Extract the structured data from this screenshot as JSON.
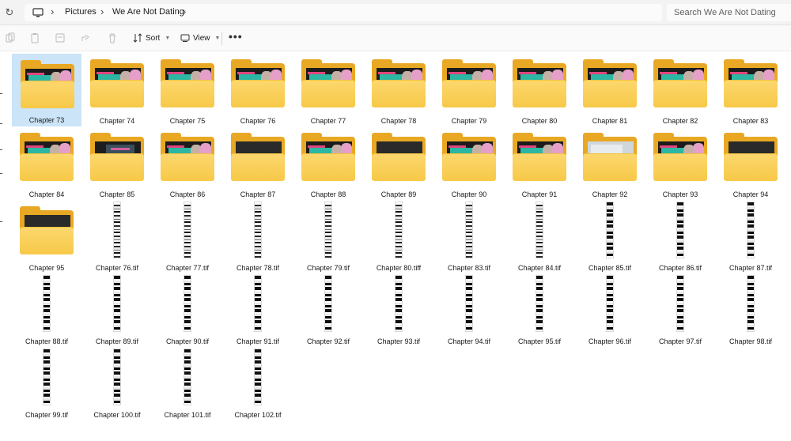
{
  "address": {
    "refresh_icon": "refresh-icon",
    "computer_icon": "computer-icon",
    "breadcrumbs": [
      "Pictures",
      "We Are Not Dating"
    ],
    "separator": "›"
  },
  "search": {
    "placeholder": "Search We Are Not Dating",
    "value": ""
  },
  "toolbar": {
    "sort_label": "Sort",
    "view_label": "View",
    "more_label": "•••",
    "icons": [
      "cut-icon",
      "copy-icon",
      "paste-icon",
      "share-icon",
      "delete-icon"
    ]
  },
  "colors": {
    "selection": "#cce4f7",
    "folder": "#f7c948",
    "accent_teal": "#2bb7a3"
  },
  "items": [
    {
      "name": "Chapter 73",
      "kind": "folder",
      "thumb": "comic",
      "selected": true
    },
    {
      "name": "Chapter 74",
      "kind": "folder",
      "thumb": "comic"
    },
    {
      "name": "Chapter 75",
      "kind": "folder",
      "thumb": "comic"
    },
    {
      "name": "Chapter 76",
      "kind": "folder",
      "thumb": "comic"
    },
    {
      "name": "Chapter 77",
      "kind": "folder",
      "thumb": "comic"
    },
    {
      "name": "Chapter 78",
      "kind": "folder",
      "thumb": "comic"
    },
    {
      "name": "Chapter 79",
      "kind": "folder",
      "thumb": "comic"
    },
    {
      "name": "Chapter 80",
      "kind": "folder",
      "thumb": "comic"
    },
    {
      "name": "Chapter 81",
      "kind": "folder",
      "thumb": "comic"
    },
    {
      "name": "Chapter 82",
      "kind": "folder",
      "thumb": "comic"
    },
    {
      "name": "Chapter 83",
      "kind": "folder",
      "thumb": "comic"
    },
    {
      "name": "Chapter 84",
      "kind": "folder",
      "thumb": "comic"
    },
    {
      "name": "Chapter 85",
      "kind": "folder",
      "thumb": "laptop"
    },
    {
      "name": "Chapter 86",
      "kind": "folder",
      "thumb": "comic"
    },
    {
      "name": "Chapter 87",
      "kind": "folder",
      "thumb": "blur"
    },
    {
      "name": "Chapter 88",
      "kind": "folder",
      "thumb": "comic"
    },
    {
      "name": "Chapter 89",
      "kind": "folder",
      "thumb": "blur"
    },
    {
      "name": "Chapter 90",
      "kind": "folder",
      "thumb": "comic"
    },
    {
      "name": "Chapter 91",
      "kind": "folder",
      "thumb": "comic"
    },
    {
      "name": "Chapter 92",
      "kind": "folder",
      "thumb": "light"
    },
    {
      "name": "Chapter 93",
      "kind": "folder",
      "thumb": "comic"
    },
    {
      "name": "Chapter 94",
      "kind": "folder",
      "thumb": "blur"
    },
    {
      "name": "Chapter 95",
      "kind": "folder",
      "thumb": "blur"
    },
    {
      "name": "Chapter 76.tif",
      "kind": "tif",
      "thumb": "light"
    },
    {
      "name": "Chapter 77.tif",
      "kind": "tif",
      "thumb": "light"
    },
    {
      "name": "Chapter 78.tif",
      "kind": "tif",
      "thumb": "light"
    },
    {
      "name": "Chapter 79.tif",
      "kind": "tif",
      "thumb": "light"
    },
    {
      "name": "Chapter 80.tiff",
      "kind": "tif",
      "thumb": "light"
    },
    {
      "name": "Chapter 83.tif",
      "kind": "tif",
      "thumb": "light"
    },
    {
      "name": "Chapter 84.tif",
      "kind": "tif",
      "thumb": "light"
    },
    {
      "name": "Chapter 85.tif",
      "kind": "tif",
      "thumb": "dark"
    },
    {
      "name": "Chapter 86.tif",
      "kind": "tif",
      "thumb": "dark"
    },
    {
      "name": "Chapter 87.tif",
      "kind": "tif",
      "thumb": "dark"
    },
    {
      "name": "Chapter 88.tif",
      "kind": "tif",
      "thumb": "dark"
    },
    {
      "name": "Chapter 89.tif",
      "kind": "tif",
      "thumb": "dark"
    },
    {
      "name": "Chapter 90.tif",
      "kind": "tif",
      "thumb": "dark"
    },
    {
      "name": "Chapter 91.tif",
      "kind": "tif",
      "thumb": "dark"
    },
    {
      "name": "Chapter 92.tif",
      "kind": "tif",
      "thumb": "dark"
    },
    {
      "name": "Chapter 93.tif",
      "kind": "tif",
      "thumb": "dark"
    },
    {
      "name": "Chapter 94.tif",
      "kind": "tif",
      "thumb": "dark"
    },
    {
      "name": "Chapter 95.tif",
      "kind": "tif",
      "thumb": "dark"
    },
    {
      "name": "Chapter 96.tif",
      "kind": "tif",
      "thumb": "dark"
    },
    {
      "name": "Chapter 97.tif",
      "kind": "tif",
      "thumb": "dark"
    },
    {
      "name": "Chapter 98.tif",
      "kind": "tif",
      "thumb": "dark"
    },
    {
      "name": "Chapter 99.tif",
      "kind": "tif",
      "thumb": "dark"
    },
    {
      "name": "Chapter 100.tif",
      "kind": "tif",
      "thumb": "dark"
    },
    {
      "name": "Chapter 101.tif",
      "kind": "tif",
      "thumb": "dark"
    },
    {
      "name": "Chapter 102.tif",
      "kind": "tif",
      "thumb": "dark"
    }
  ]
}
